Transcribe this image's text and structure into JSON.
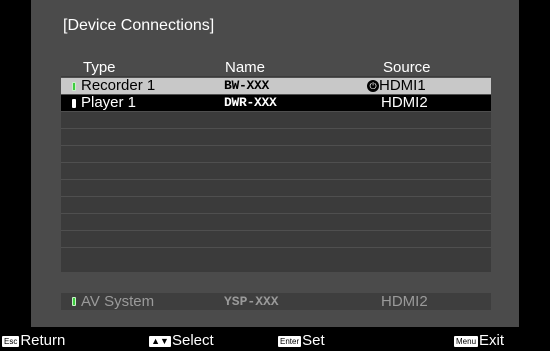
{
  "title": "[Device Connections]",
  "columns": {
    "type": "Type",
    "name": "Name",
    "source": "Source"
  },
  "rows": [
    {
      "type": "Recorder 1",
      "name": "BW-XXX",
      "source": "HDMI1",
      "led": "green-led-icon",
      "active_source_icon": "power-source-icon"
    },
    {
      "type": "Player 1",
      "name": "DWR-XXX",
      "source": "HDMI2",
      "led": "white-led-icon"
    }
  ],
  "av_system": {
    "type": "AV System",
    "name": "YSP-XXX",
    "source": "HDMI2",
    "led": "green-led-icon"
  },
  "footer": {
    "return_key": "Esc",
    "return_label": "Return",
    "select_key": "▲▼",
    "select_label": "Select",
    "set_key": "Enter",
    "set_label": "Set",
    "exit_key": "Menu",
    "exit_label": "Exit"
  }
}
